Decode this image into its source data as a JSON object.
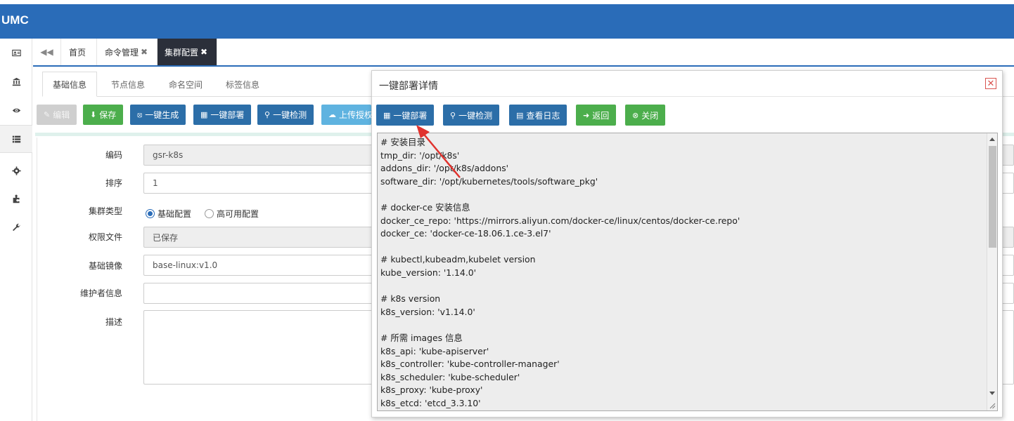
{
  "app": {
    "logo": "UMC",
    "brand_color": "#2a6cb8"
  },
  "sidebar": {
    "items": [
      {
        "icon": "id-card-icon"
      },
      {
        "icon": "bank-icon"
      },
      {
        "icon": "eye-icon"
      },
      {
        "icon": "list-icon",
        "active": true
      },
      {
        "icon": "gear-icon"
      },
      {
        "icon": "puzzle-icon"
      },
      {
        "icon": "wrench-icon"
      }
    ]
  },
  "tabs": {
    "back_icon": "double-chevron-left-icon",
    "items": [
      {
        "label": "首页"
      },
      {
        "label": "命令管理",
        "close": "✖"
      },
      {
        "label": "集群配置",
        "close": "✖",
        "active": true
      }
    ]
  },
  "inner_tabs": [
    "基础信息",
    "节点信息",
    "命名空间",
    "标签信息"
  ],
  "toolbar": {
    "edit": "编辑",
    "save": "保存",
    "generate": "一键生成",
    "deploy": "一键部署",
    "check": "一键检测",
    "upload": "上传授权"
  },
  "form": {
    "code_label": "编码",
    "code_value": "gsr-k8s",
    "order_label": "排序",
    "order_value": "1",
    "type_label": "集群类型",
    "type_option_basic": "基础配置",
    "type_option_ha": "高可用配置",
    "type_selected": "基础配置",
    "perm_label": "权限文件",
    "perm_value": "已保存",
    "image_label": "基础镜像",
    "image_value": "base-linux:v1.0",
    "maintainer_label": "维护者信息",
    "maintainer_value": "",
    "desc_label": "描述",
    "desc_value": ""
  },
  "modal": {
    "title": "一键部署详情",
    "close": "✕",
    "buttons": {
      "deploy": "一键部署",
      "check": "一键检测",
      "log": "查看日志",
      "back": "返回",
      "close": "关闭"
    },
    "code": "# 安装目录\ntmp_dir: '/opt/k8s'\naddons_dir: '/opt/k8s/addons'\nsoftware_dir: '/opt/kubernetes/tools/software_pkg'\n\n# docker-ce 安装信息\ndocker_ce_repo: 'https://mirrors.aliyun.com/docker-ce/linux/centos/docker-ce.repo'\ndocker_ce: 'docker-ce-18.06.1.ce-3.el7'\n\n# kubectl,kubeadm,kubelet version\nkube_version: '1.14.0'\n\n# k8s version\nk8s_version: 'v1.14.0'\n\n# 所需 images 信息\nk8s_api: 'kube-apiserver'\nk8s_controller: 'kube-controller-manager'\nk8s_scheduler: 'kube-scheduler'\nk8s_proxy: 'kube-proxy'\nk8s_etcd: 'etcd_3.3.10'"
  },
  "annotation": {
    "color": "#e0332e"
  }
}
